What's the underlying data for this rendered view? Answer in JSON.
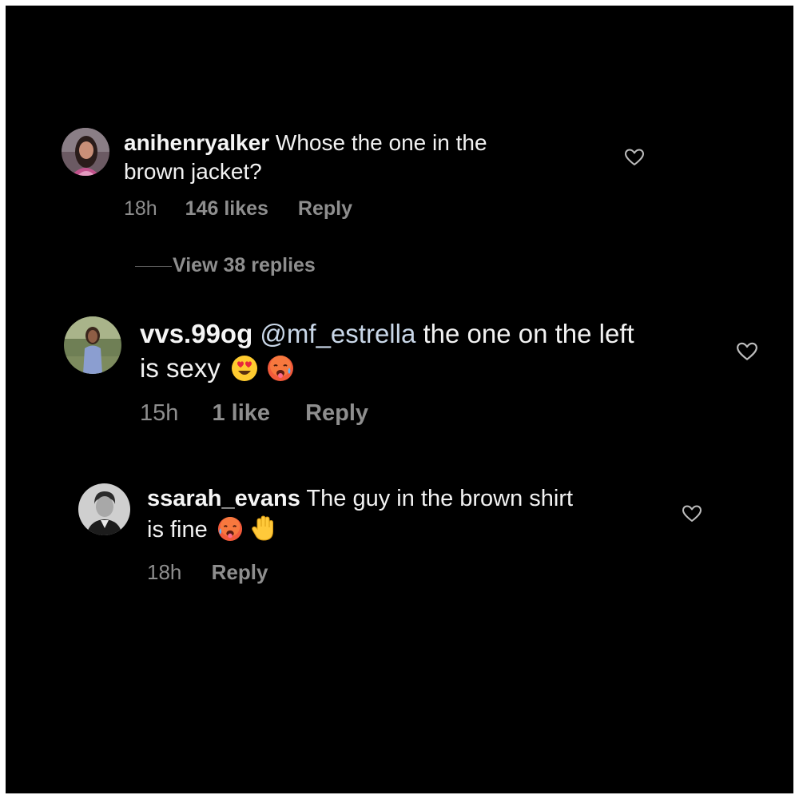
{
  "comments": [
    {
      "username": "anihenryalker",
      "text_line1": "Whose the one in the",
      "text_line2": "brown jacket?",
      "time": "18h",
      "likes": "146 likes",
      "reply": "Reply",
      "view_replies": "View 38 replies",
      "avatar": "woman-portrait-avatar",
      "heart_icon": "heart-outline-icon"
    },
    {
      "username": "vvs.99og",
      "mention": "@mf_estrella",
      "text_line1": "the one on the left",
      "text_line2": "is sexy",
      "emojis": [
        "heart-eyes-emoji",
        "hot-face-emoji"
      ],
      "time": "15h",
      "likes": "1 like",
      "reply": "Reply",
      "avatar": "woman-outdoor-avatar",
      "heart_icon": "heart-outline-icon"
    },
    {
      "username": "ssarah_evans",
      "text_line1": "The guy in the brown shirt",
      "text_line2": "is fine",
      "emojis": [
        "hot-face-emoji",
        "raised-hand-emoji"
      ],
      "time": "18h",
      "reply": "Reply",
      "avatar": "man-bw-avatar",
      "heart_icon": "heart-outline-icon"
    }
  ],
  "colors": {
    "background": "#000000",
    "text": "#f2f2f2",
    "secondary": "#8e8e8e",
    "mention": "#c9d7e8"
  }
}
